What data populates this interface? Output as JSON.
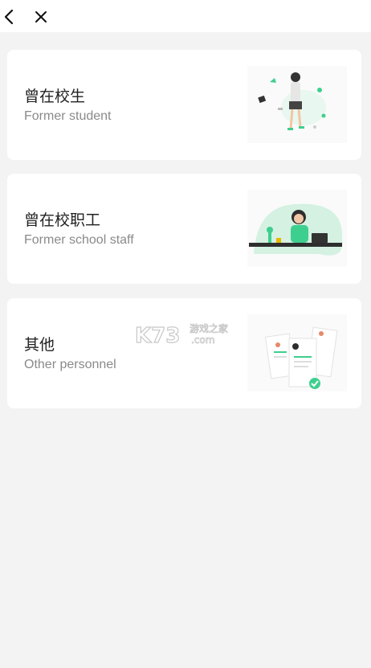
{
  "nav": {
    "back_icon": "chevron-left-icon",
    "close_icon": "close-icon"
  },
  "cards": [
    {
      "title": "曾在校生",
      "subtitle": "Former student",
      "illustration": "student-walking-illustration"
    },
    {
      "title": "曾在校职工",
      "subtitle": "Former school staff",
      "illustration": "staff-at-desk-illustration"
    },
    {
      "title": "其他",
      "subtitle": "Other personnel",
      "illustration": "resume-documents-illustration"
    }
  ],
  "watermark": {
    "brand": "K73",
    "text_top": "游戏之家",
    "text_bottom": ".com"
  },
  "colors": {
    "background": "#f3f3f3",
    "card": "#ffffff",
    "accent_green": "#3ecf8e",
    "title": "#222222",
    "subtitle": "#8a8a8a"
  }
}
